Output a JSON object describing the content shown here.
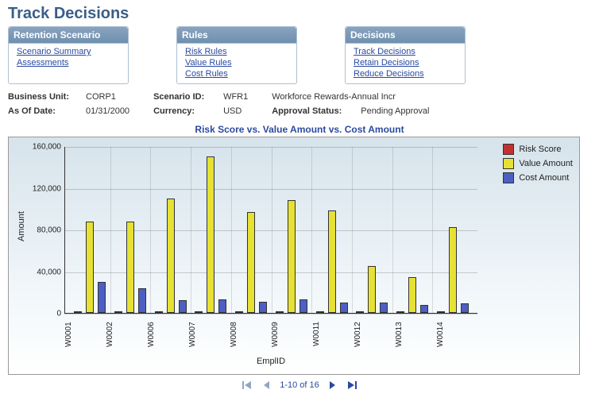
{
  "page_title": "Track Decisions",
  "boxes": {
    "retention": {
      "title": "Retention Scenario",
      "links": [
        "Scenario Summary",
        "Assessments"
      ]
    },
    "rules": {
      "title": "Rules",
      "links": [
        "Risk Rules",
        "Value Rules",
        "Cost Rules"
      ]
    },
    "decisions": {
      "title": "Decisions",
      "links": [
        "Track Decisions",
        "Retain Decisions",
        "Reduce Decisions"
      ]
    }
  },
  "meta": {
    "business_unit_label": "Business Unit:",
    "business_unit": "CORP1",
    "as_of_label": "As Of Date:",
    "as_of": "01/31/2000",
    "scenario_id_label": "Scenario ID:",
    "scenario_id": "WFR1",
    "currency_label": "Currency:",
    "currency": "USD",
    "scenario_desc": "Workforce Rewards-Annual Incr",
    "approval_label": "Approval Status:",
    "approval_status": "Pending Approval"
  },
  "chart_title": "Risk Score vs. Value Amount vs. Cost Amount",
  "chart_data": {
    "type": "bar",
    "title": "Risk Score vs. Value Amount vs. Cost Amount",
    "xlabel": "EmplID",
    "ylabel": "Amount",
    "ylim": [
      0,
      160000
    ],
    "yticks": [
      0,
      40000,
      80000,
      120000,
      160000
    ],
    "categories": [
      "W0001",
      "W0002",
      "W0006",
      "W0007",
      "W0008",
      "W0009",
      "W0011",
      "W0012",
      "W0013",
      "W0014"
    ],
    "series": [
      {
        "name": "Risk Score",
        "color": "#c62f2f",
        "values": [
          200,
          200,
          200,
          200,
          200,
          200,
          200,
          200,
          200,
          200
        ]
      },
      {
        "name": "Value Amount",
        "color": "#e6e133",
        "values": [
          88000,
          88000,
          110000,
          150000,
          97000,
          108000,
          98000,
          45000,
          34000,
          82000
        ]
      },
      {
        "name": "Cost Amount",
        "color": "#4d5fc4",
        "values": [
          30000,
          24000,
          12000,
          13000,
          11000,
          13000,
          10000,
          10000,
          8000,
          9000
        ]
      }
    ],
    "legend_position": "right"
  },
  "pager": {
    "text": "1-10 of 16"
  }
}
